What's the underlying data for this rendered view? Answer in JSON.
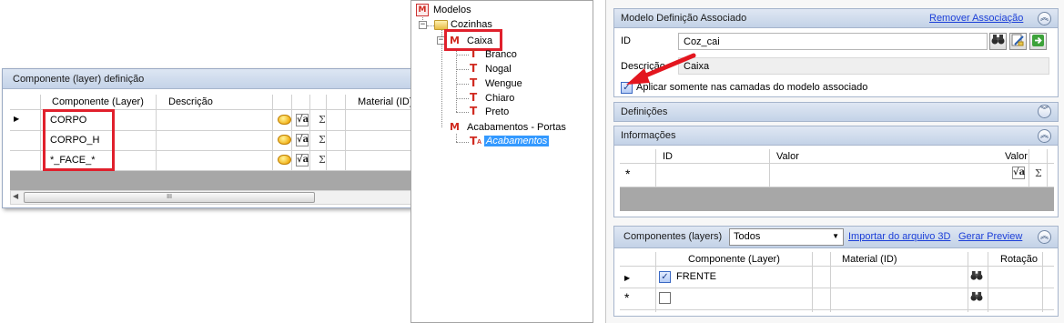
{
  "left_panel": {
    "title": "Componente (layer) definição",
    "columns": [
      "Componente (Layer)",
      "Descrição",
      "Material (ID)"
    ],
    "rows": [
      {
        "componente": "CORPO",
        "descricao": ""
      },
      {
        "componente": "CORPO_H",
        "descricao": ""
      },
      {
        "componente": "*_FACE_*",
        "descricao": ""
      }
    ],
    "scroll_grip": "III",
    "sigma": "Σ",
    "sqrt_label": "√a"
  },
  "tree": {
    "root": "Modelos",
    "cozinhas": "Cozinhas",
    "caixa": "Caixa",
    "finishes": [
      "Branco",
      "Nogal",
      "Wengue",
      "Chiaro",
      "Preto"
    ],
    "acabamentos_portas": "Acabamentos - Portas",
    "acabamentos": "Acabamentos",
    "expanders": {
      "collapsed": "+",
      "expanded": "−"
    }
  },
  "right_panel": {
    "modelo": {
      "title": "Modelo Definição Associado",
      "remove_link": "Remover Associação",
      "id_label": "ID",
      "id_value": "Coz_cai",
      "descricao_label": "Descrição",
      "descricao_value": "Caixa",
      "checkbox_label": "Aplicar somente nas camadas do modelo associado",
      "checkbox_checked": true
    },
    "definicoes": {
      "title": "Definições"
    },
    "informacoes": {
      "title": "Informações",
      "columns": [
        "ID",
        "Valor",
        "Valor"
      ],
      "new_row_marker": "*"
    },
    "componentes": {
      "title": "Componentes (layers)",
      "filter_value": "Todos",
      "import_link": "Importar do arquivo 3D",
      "preview_link": "Gerar Preview",
      "columns": [
        "Componente (Layer)",
        "Material (ID)",
        "Rotação"
      ],
      "rows": [
        {
          "checked": true,
          "componente": "FRENTE"
        },
        {
          "checked": false,
          "componente": ""
        }
      ],
      "new_row_marker": "*"
    }
  },
  "icons": {
    "collapse_up": "︽",
    "expand_down": "︾",
    "binoculars": "⛶",
    "arrow_green": "➔",
    "checkmark": "✓"
  },
  "colors": {
    "header_gradient_top": "#dde6f3",
    "header_gradient_bottom": "#c4d3e8",
    "link": "#1c3fd8",
    "highlight_box": "#e0202c",
    "selection": "#3399ff"
  }
}
